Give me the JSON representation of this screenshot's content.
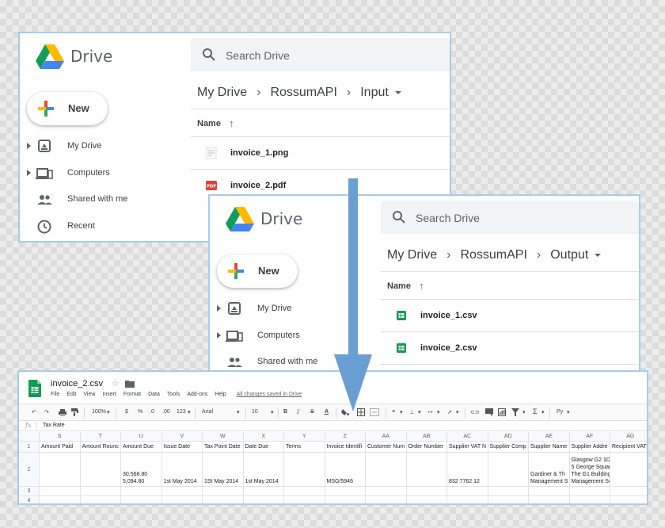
{
  "drive_input": {
    "logo_text": "Drive",
    "new_label": "New",
    "nav": [
      {
        "label": "My Drive",
        "icon": "my-drive-icon",
        "caret": true
      },
      {
        "label": "Computers",
        "icon": "computers-icon",
        "caret": true
      },
      {
        "label": "Shared with me",
        "icon": "shared-icon",
        "caret": false
      },
      {
        "label": "Recent",
        "icon": "recent-icon",
        "caret": false
      }
    ],
    "search_placeholder": "Search Drive",
    "breadcrumb": [
      "My Drive",
      "RossumAPI",
      "Input"
    ],
    "name_header": "Name",
    "files": [
      {
        "name": "invoice_1.png",
        "icon": "image-file-icon"
      },
      {
        "name": "invoice_2.pdf",
        "icon": "pdf-file-icon"
      }
    ]
  },
  "drive_output": {
    "logo_text": "Drive",
    "new_label": "New",
    "nav": [
      {
        "label": "My Drive",
        "icon": "my-drive-icon",
        "caret": true
      },
      {
        "label": "Computers",
        "icon": "computers-icon",
        "caret": true
      },
      {
        "label": "Shared with me",
        "icon": "shared-icon",
        "caret": false
      }
    ],
    "search_placeholder": "Search Drive",
    "breadcrumb": [
      "My Drive",
      "RossumAPI",
      "Output"
    ],
    "name_header": "Name",
    "files": [
      {
        "name": "invoice_1.csv",
        "icon": "sheets-file-icon"
      },
      {
        "name": "invoice_2.csv",
        "icon": "sheets-file-icon"
      }
    ]
  },
  "sheet": {
    "title": "invoice_2.csv",
    "menu": [
      "File",
      "Edit",
      "View",
      "Insert",
      "Format",
      "Data",
      "Tools",
      "Add-ons",
      "Help"
    ],
    "saved_status": "All changes saved in Drive",
    "toolbar": {
      "zoom": "100%",
      "currency": "$",
      "percent": "%",
      "dec_less": ".0",
      "dec_more": ".00",
      "format": "123",
      "font": "Arial",
      "size": "10",
      "bold": "B",
      "italic": "I",
      "strike": "S",
      "text_color": "A",
      "sum": "Σ",
      "input_tools": "Py"
    },
    "formula_bar": {
      "fx": "fx",
      "value": "Tax Rate"
    },
    "columns": [
      "S",
      "T",
      "U",
      "V",
      "W",
      "X",
      "Y",
      "Z",
      "AA",
      "AB",
      "AC",
      "AD",
      "AE",
      "AF",
      "AG"
    ],
    "rows": [
      "1",
      "2",
      "3",
      "4"
    ],
    "header_row": [
      "Amount Paid",
      "Amount Rounc",
      "Amount Due",
      "Issue Date",
      "Tax Point Date",
      "Date Due",
      "Terms",
      "Invoice Identifi",
      "Customer Num",
      "Order Number",
      "Supplier VAT N",
      "Supplier Comp",
      "Supplier Name",
      "Supplier Addre",
      "Recipient VAT"
    ],
    "data_row": [
      [],
      [],
      [
        "30,568.80",
        "5,094.80"
      ],
      [
        "1st May 2014"
      ],
      [
        "1St May 2014"
      ],
      [
        "1st May 2014"
      ],
      [],
      [
        "MSG/5946"
      ],
      [],
      [],
      [
        "832 7762 12"
      ],
      [],
      [
        "Gardiner & Th",
        "Management S"
      ],
      [
        "Glasgow G2 1DY",
        "5 George Square",
        "The G1 Building",
        "Management Services"
      ],
      []
    ]
  },
  "colors": {
    "window_border": "#a9cce9",
    "flow_arrow": "#6a9fd4",
    "sheets_green": "#0f9d58",
    "pdf_red": "#db4437"
  }
}
